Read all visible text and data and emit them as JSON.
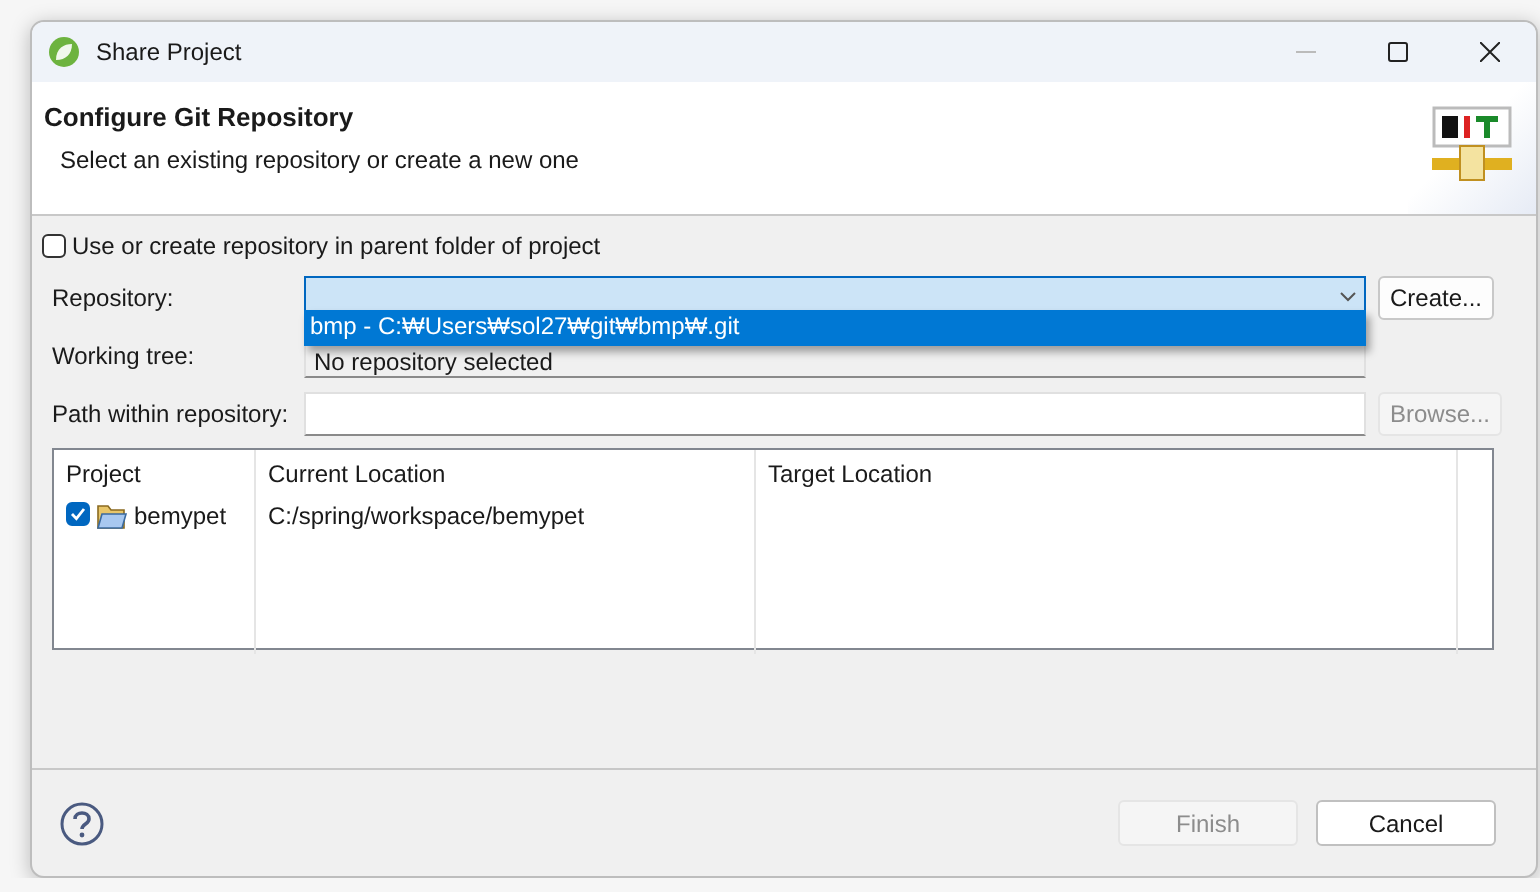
{
  "window": {
    "title": "Share Project"
  },
  "header": {
    "title": "Configure Git Repository",
    "subtitle": "Select an existing repository or create a new one"
  },
  "parent_folder_option": {
    "label": "Use or create repository in parent folder of project",
    "checked": false
  },
  "repository": {
    "label": "Repository:",
    "expanded": true,
    "options": [
      {
        "label": "bmp - C:₩Users₩sol27₩git₩bmp₩.git",
        "selected": true
      }
    ],
    "button": {
      "label": "Create...",
      "disabled": false
    }
  },
  "working_tree": {
    "label": "Working tree:",
    "value": "No repository selected"
  },
  "path_within": {
    "label": "Path within repository:",
    "button": {
      "label": "Browse...",
      "disabled": true
    }
  },
  "table": {
    "columns": [
      "Project",
      "Current Location",
      "Target Location"
    ],
    "rows": [
      {
        "checked": true,
        "project": "bemypet",
        "current_location": "C:/spring/workspace/bemypet"
      }
    ]
  },
  "buttons": [
    {
      "label": "Finish",
      "disabled": true
    },
    {
      "label": "Cancel",
      "disabled": false
    }
  ]
}
